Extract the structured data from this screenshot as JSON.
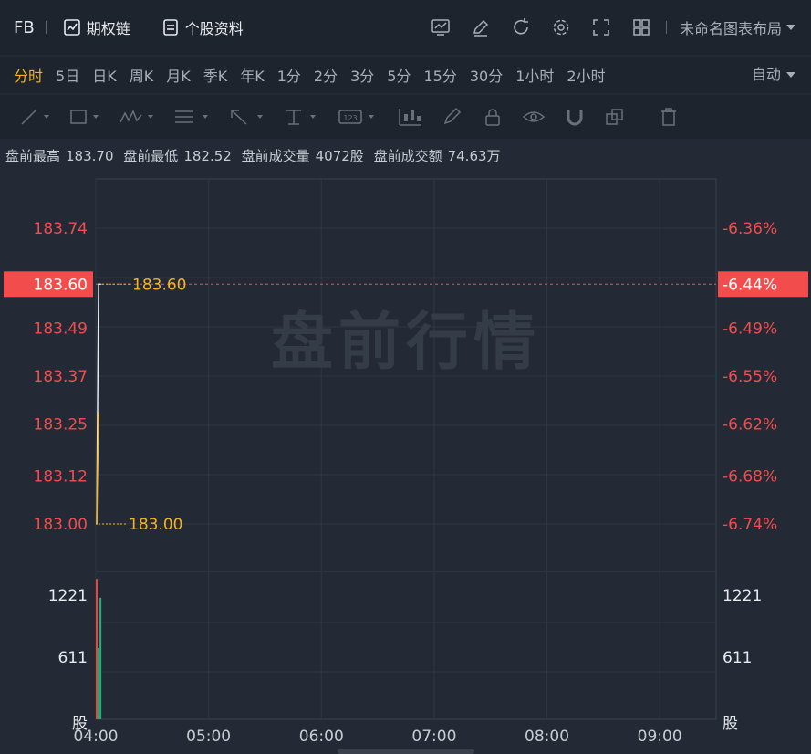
{
  "header": {
    "symbol": "FB",
    "options_chain": "期权链",
    "stock_profile": "个股资料",
    "layout_name": "未命名图表布局"
  },
  "periods": {
    "items": [
      "分时",
      "5日",
      "日K",
      "周K",
      "月K",
      "季K",
      "年K",
      "1分",
      "2分",
      "3分",
      "5分",
      "15分",
      "30分",
      "1小时",
      "2小时"
    ],
    "active_index": 0,
    "auto_label": "自动"
  },
  "stats": {
    "high_label": "盘前最高",
    "high": "183.70",
    "low_label": "盘前最低",
    "low": "182.52",
    "vol_label": "盘前成交量",
    "vol": "4072股",
    "amt_label": "盘前成交额",
    "amt": "74.63万"
  },
  "chart_data": {
    "type": "line",
    "watermark": "盘前行情",
    "price_ticks": [
      {
        "price": "183.74",
        "pct": "-6.36%"
      },
      {
        "price": "183.60",
        "pct": "-6.44%"
      },
      {
        "price": "183.49",
        "pct": "-6.49%"
      },
      {
        "price": "183.37",
        "pct": "-6.55%"
      },
      {
        "price": "183.25",
        "pct": "-6.62%"
      },
      {
        "price": "183.12",
        "pct": "-6.68%"
      },
      {
        "price": "183.00",
        "pct": "-6.74%"
      }
    ],
    "current_price": "183.60",
    "current_pct": "-6.44%",
    "high_marker": "183.60",
    "low_marker": "183.00",
    "y_range": [
      183.0,
      183.74
    ],
    "time_labels": [
      "04:00",
      "05:00",
      "06:00",
      "07:00",
      "08:00",
      "09:00"
    ],
    "volume_ticks": [
      "1221",
      "611"
    ],
    "volume_unit": "股",
    "price_series": [
      {
        "t": "04:00",
        "price": 183.0
      },
      {
        "t": "04:01",
        "price": 183.6
      },
      {
        "t": "04:02",
        "price": 183.6
      }
    ],
    "avg_series": [
      {
        "t": "04:00",
        "price": 183.0
      },
      {
        "t": "04:01",
        "price": 183.28
      }
    ],
    "volume_bars": [
      {
        "t": "04:00",
        "volume": 1380,
        "color": "#e8473c"
      },
      {
        "t": "04:01",
        "volume": 700,
        "color": "#26b07a"
      },
      {
        "t": "04:02",
        "volume": 1195,
        "color": "#26b07a"
      }
    ],
    "volume_range": [
      0,
      1400
    ],
    "colors": {
      "price": "#e6e9ee",
      "avg": "#f5b31d",
      "up": "#e8473c",
      "down": "#26b07a",
      "accent": "#f24c4c"
    }
  }
}
